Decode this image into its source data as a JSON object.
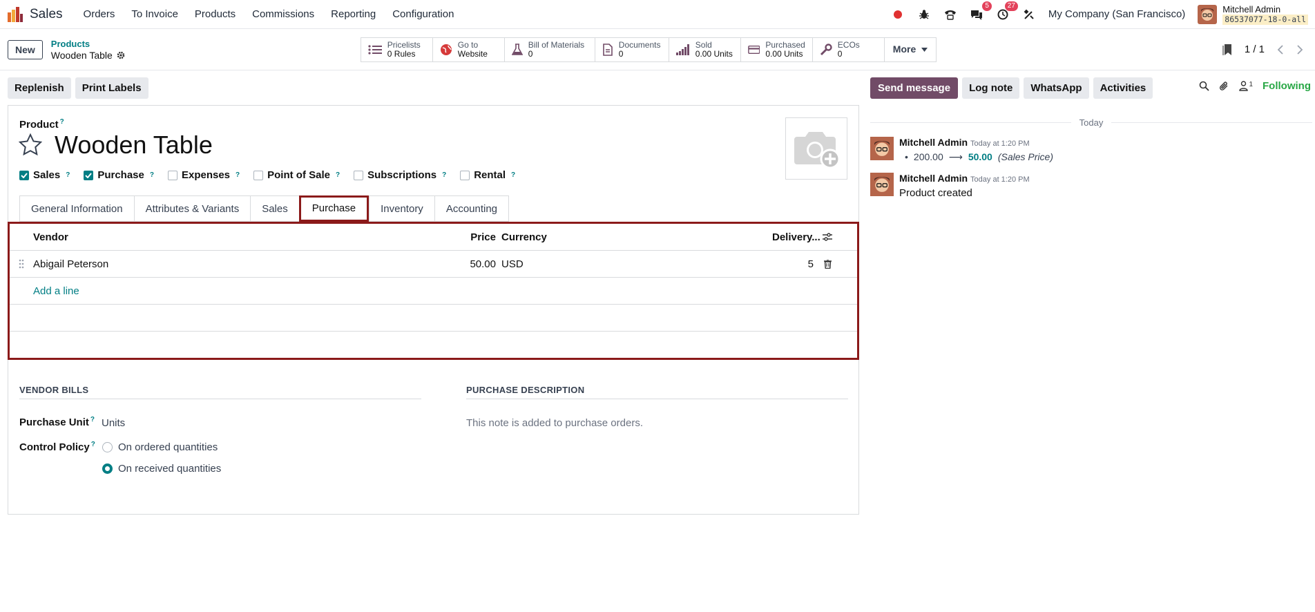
{
  "topbar": {
    "app_name": "Sales",
    "menu": [
      "Orders",
      "To Invoice",
      "Products",
      "Commissions",
      "Reporting",
      "Configuration"
    ],
    "chat_badge": "5",
    "activity_badge": "27",
    "company": "My Company (San Francisco)",
    "user_name": "Mitchell Admin",
    "db_name": "86537077-18-0-all"
  },
  "control": {
    "new_label": "New",
    "breadcrumb_parent": "Products",
    "breadcrumb_current": "Wooden Table",
    "smart_buttons": [
      {
        "title": "Pricelists",
        "value": "0 Rules",
        "icon": "list-icon"
      },
      {
        "title": "Go to",
        "value": "Website",
        "icon": "globe-icon"
      },
      {
        "title": "Bill of Materials",
        "value": "0",
        "icon": "flask-icon"
      },
      {
        "title": "Documents",
        "value": "0",
        "icon": "document-icon"
      },
      {
        "title": "Sold",
        "value": "0.00 Units",
        "icon": "signal-icon"
      },
      {
        "title": "Purchased",
        "value": "0.00 Units",
        "icon": "credit-card-icon"
      },
      {
        "title": "ECOs",
        "value": "0",
        "icon": "wrench-icon"
      }
    ],
    "more_label": "More",
    "pager": "1 / 1"
  },
  "actions": {
    "replenish": "Replenish",
    "print_labels": "Print Labels"
  },
  "chat_actions": {
    "send_message": "Send message",
    "log_note": "Log note",
    "whatsapp": "WhatsApp",
    "activities": "Activities",
    "follower_count": "1",
    "following": "Following"
  },
  "product": {
    "label": "Product",
    "help": "?",
    "name": "Wooden Table",
    "flags": [
      {
        "label": "Sales",
        "checked": true
      },
      {
        "label": "Purchase",
        "checked": true
      },
      {
        "label": "Expenses",
        "checked": false
      },
      {
        "label": "Point of Sale",
        "checked": false
      },
      {
        "label": "Subscriptions",
        "checked": false
      },
      {
        "label": "Rental",
        "checked": false
      }
    ],
    "tabs": [
      "General Information",
      "Attributes & Variants",
      "Sales",
      "Purchase",
      "Inventory",
      "Accounting"
    ],
    "active_tab": "Purchase"
  },
  "vendors": {
    "headers": {
      "vendor": "Vendor",
      "price": "Price",
      "currency": "Currency",
      "delivery": "Delivery..."
    },
    "rows": [
      {
        "vendor": "Abigail Peterson",
        "price": "50.00",
        "currency": "USD",
        "delivery": "5"
      }
    ],
    "add_line": "Add a line"
  },
  "vendor_bills": {
    "title": "VENDOR BILLS",
    "purchase_unit_label": "Purchase Unit",
    "purchase_unit_value": "Units",
    "control_policy_label": "Control Policy",
    "option_ordered": "On ordered quantities",
    "option_received": "On received quantities",
    "selected": "received"
  },
  "purchase_description": {
    "title": "PURCHASE DESCRIPTION",
    "placeholder": "This note is added to purchase orders."
  },
  "chatter": {
    "day": "Today",
    "messages": [
      {
        "author": "Mitchell Admin",
        "time": "Today at 1:20 PM",
        "old": "200.00",
        "new": "50.00",
        "field": "(Sales Price)"
      },
      {
        "author": "Mitchell Admin",
        "time": "Today at 1:20 PM",
        "text": "Product created"
      }
    ]
  }
}
